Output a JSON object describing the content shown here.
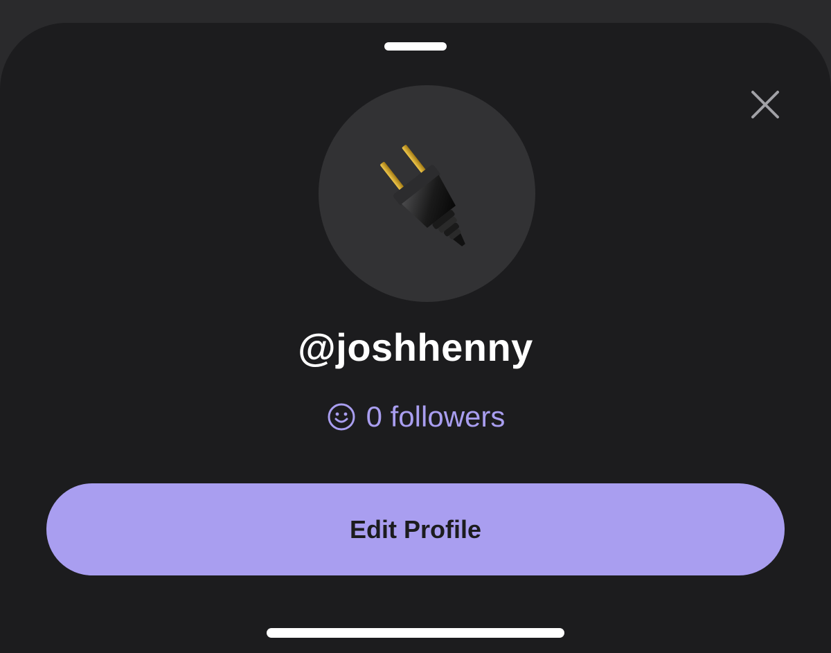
{
  "profile": {
    "username": "@joshhenny",
    "followers_count": "0",
    "followers_label": "followers",
    "avatar_icon": "electric-plug-icon"
  },
  "actions": {
    "edit_profile_label": "Edit Profile",
    "close_icon": "close-icon"
  },
  "colors": {
    "sheet_background": "#1c1c1e",
    "accent": "#a99ef0",
    "avatar_background": "#323234"
  }
}
